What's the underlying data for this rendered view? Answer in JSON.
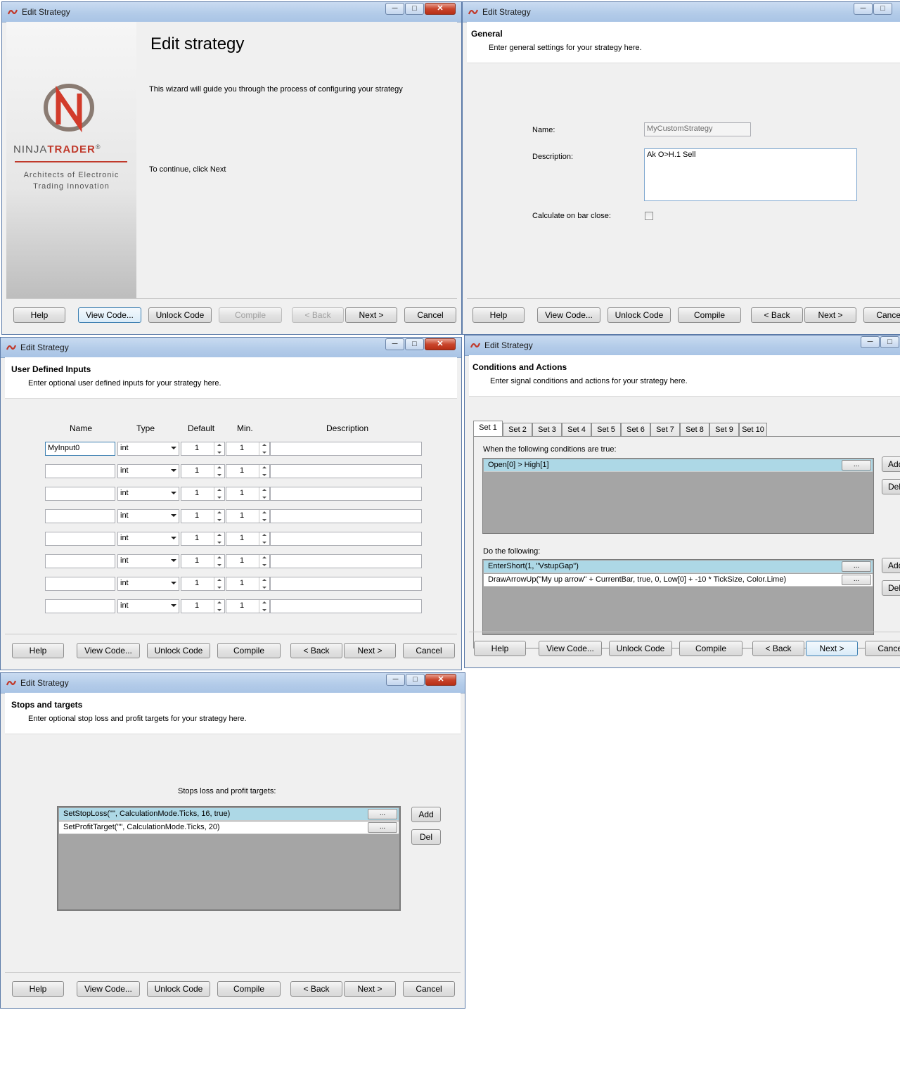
{
  "window_title": "Edit Strategy",
  "window_controls": {
    "minimize": "─",
    "maximize": "□",
    "close": "✕"
  },
  "buttons": {
    "help": "Help",
    "view_code": "View Code...",
    "unlock_code": "Unlock Code",
    "compile": "Compile",
    "back": "< Back",
    "next": "Next >",
    "cancel": "Cancel"
  },
  "buttons_cut": {
    "cancel": "Cancel",
    "add": "Add",
    "del": "Del"
  },
  "welcome": {
    "title": "Edit strategy",
    "intro": "This wizard will guide you through the process of configuring your strategy",
    "continue": "To continue, click Next",
    "logo_text_a": "NINJA",
    "logo_text_b": "TRADER",
    "logo_reg": "®",
    "tagline_1": "Architects of Electronic",
    "tagline_2": "Trading Innovation"
  },
  "general": {
    "title": "General",
    "subtitle": "Enter general settings for your strategy here.",
    "name_label": "Name:",
    "name_value": "MyCustomStrategy",
    "description_label": "Description:",
    "description_value": "Ak O>H.1 Sell",
    "calc_label": "Calculate on bar close:"
  },
  "inputs": {
    "title": "User Defined Inputs",
    "subtitle": "Enter optional user defined inputs for your strategy here.",
    "columns": {
      "name": "Name",
      "type": "Type",
      "default": "Default",
      "min": "Min.",
      "description": "Description"
    },
    "rows": [
      {
        "name": "MyInput0",
        "type": "int",
        "default": "1",
        "min": "1"
      },
      {
        "name": "",
        "type": "int",
        "default": "1",
        "min": "1"
      },
      {
        "name": "",
        "type": "int",
        "default": "1",
        "min": "1"
      },
      {
        "name": "",
        "type": "int",
        "default": "1",
        "min": "1"
      },
      {
        "name": "",
        "type": "int",
        "default": "1",
        "min": "1"
      },
      {
        "name": "",
        "type": "int",
        "default": "1",
        "min": "1"
      },
      {
        "name": "",
        "type": "int",
        "default": "1",
        "min": "1"
      },
      {
        "name": "",
        "type": "int",
        "default": "1",
        "min": "1"
      }
    ]
  },
  "conditions": {
    "title": "Conditions and Actions",
    "subtitle": "Enter signal conditions and actions for your strategy here.",
    "tabs": [
      "Set 1",
      "Set 2",
      "Set 3",
      "Set 4",
      "Set 5",
      "Set 6",
      "Set 7",
      "Set 8",
      "Set 9",
      "Set 10"
    ],
    "when_label": "When the following conditions are true:",
    "conditions_list": [
      "Open[0] > High[1]"
    ],
    "do_label": "Do the following:",
    "actions_list": [
      "EnterShort(1, \"VstupGap\")",
      "DrawArrowUp(\"My up arrow\" + CurrentBar, true, 0, Low[0] + -10 * TickSize, Color.Lime)"
    ],
    "dots": "..."
  },
  "stops": {
    "title": "Stops and targets",
    "subtitle": "Enter optional stop loss and profit targets for your strategy here.",
    "list_label": "Stops loss and profit targets:",
    "items": [
      "SetStopLoss(\"\", CalculationMode.Ticks, 16, true)",
      "SetProfitTarget(\"\", CalculationMode.Ticks, 20)"
    ],
    "add": "Add",
    "del": "Del",
    "dots": "..."
  },
  "colors": {
    "selected_row": "#add8e6",
    "list_bg": "#a5a5a5",
    "logo_red": "#c0392b"
  }
}
